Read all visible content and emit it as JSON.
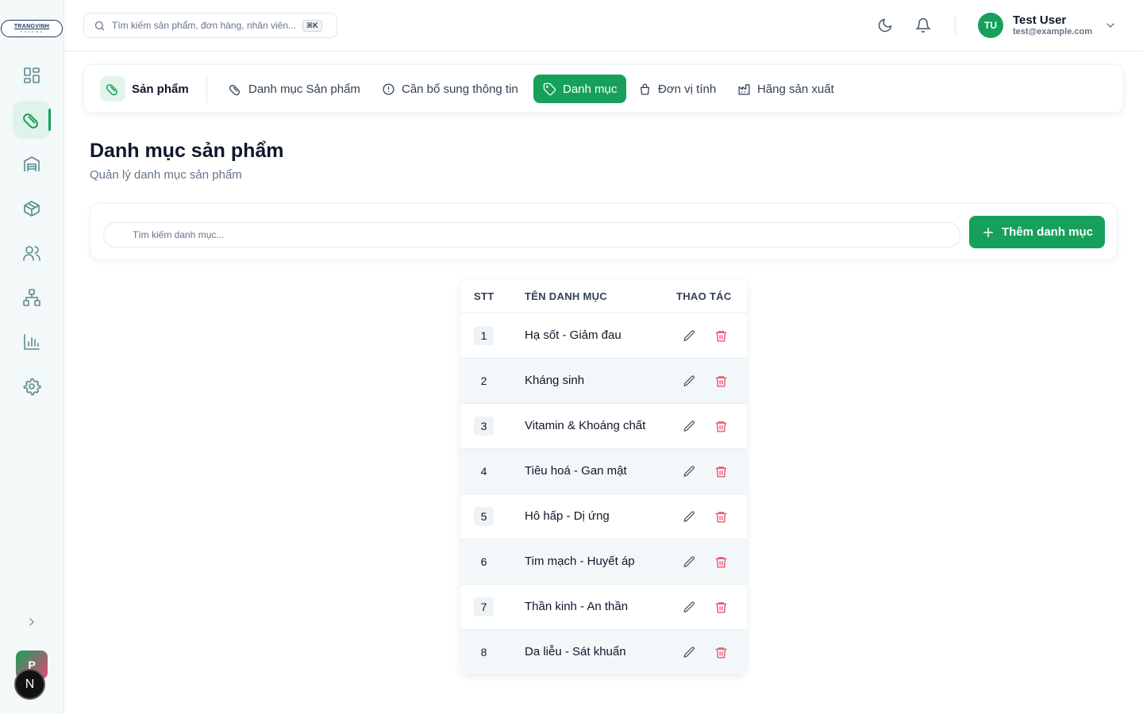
{
  "logo": {
    "text": "TRANGVINH",
    "sub": "P H A R M A"
  },
  "sidebar": {
    "items": [
      {
        "name": "dashboard",
        "icon": "grid-icon"
      },
      {
        "name": "products",
        "icon": "pill-icon",
        "active": true
      },
      {
        "name": "warehouse",
        "icon": "warehouse-icon"
      },
      {
        "name": "inventory",
        "icon": "box-icon"
      },
      {
        "name": "users",
        "icon": "users-icon"
      },
      {
        "name": "organization",
        "icon": "network-icon"
      },
      {
        "name": "reports",
        "icon": "bar-chart-icon"
      },
      {
        "name": "settings",
        "icon": "gear-icon"
      }
    ],
    "badge_p": "P",
    "badge_n": "N"
  },
  "header": {
    "search_placeholder": "Tìm kiếm sản phẩm, đơn hàng, nhân viên...",
    "shortcut": "⌘K",
    "user": {
      "initials": "TU",
      "name": "Test User",
      "email": "test@example.com"
    }
  },
  "tabs": {
    "home_label": "Sản phẩm",
    "items": [
      {
        "label": "Danh mục Sản phẩm",
        "icon": "pill-icon"
      },
      {
        "label": "Cần bổ sung thông tin",
        "icon": "alert-circle-icon"
      },
      {
        "label": "Danh mục",
        "icon": "tag-icon",
        "active": true
      },
      {
        "label": "Đơn vị tính",
        "icon": "bag-icon"
      },
      {
        "label": "Hãng sản xuất",
        "icon": "factory-icon"
      }
    ]
  },
  "page": {
    "title": "Danh mục sản phẩm",
    "subtitle": "Quản lý danh mục sản phẩm"
  },
  "toolbar": {
    "search_placeholder": "Tìm kiếm danh mục...",
    "add_label": "Thêm danh mục"
  },
  "table": {
    "headers": {
      "stt": "STT",
      "name": "TÊN DANH MỤC",
      "actions": "THAO TÁC"
    },
    "rows": [
      {
        "stt": "1",
        "name": "Hạ sốt - Giảm đau"
      },
      {
        "stt": "2",
        "name": "Kháng sinh"
      },
      {
        "stt": "3",
        "name": "Vitamin & Khoáng chất"
      },
      {
        "stt": "4",
        "name": "Tiêu hoá - Gan mật"
      },
      {
        "stt": "5",
        "name": "Hô hấp - Dị ứng"
      },
      {
        "stt": "6",
        "name": "Tim mạch - Huyết áp"
      },
      {
        "stt": "7",
        "name": "Thần kinh - An thần"
      },
      {
        "stt": "8",
        "name": "Da liễu - Sát khuẩn"
      }
    ]
  },
  "colors": {
    "primary": "#16a05c",
    "danger": "#e54863",
    "sidebar_bg": "#f3f8f9"
  }
}
